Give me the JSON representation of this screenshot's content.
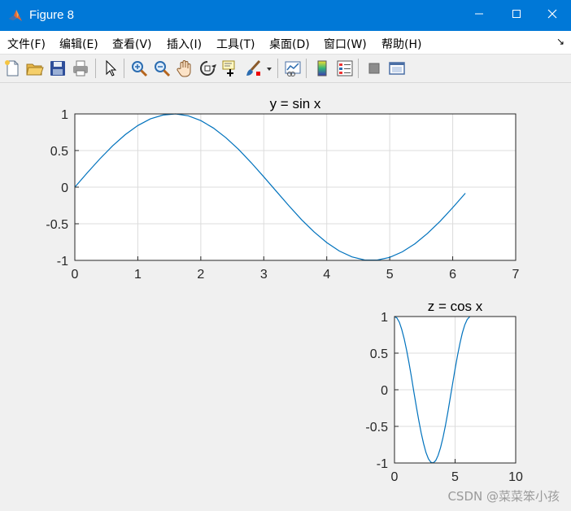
{
  "window": {
    "title": "Figure 8",
    "controls": {
      "minimize": "minimize",
      "maximize": "maximize",
      "close": "close"
    }
  },
  "menu": {
    "items": [
      {
        "label": "文件(F)"
      },
      {
        "label": "编辑(E)"
      },
      {
        "label": "查看(V)"
      },
      {
        "label": "插入(I)"
      },
      {
        "label": "工具(T)"
      },
      {
        "label": "桌面(D)"
      },
      {
        "label": "窗口(W)"
      },
      {
        "label": "帮助(H)"
      }
    ],
    "dock_glyph": "↘"
  },
  "toolbar": {
    "tools": [
      "new-figure-icon",
      "open-file-icon",
      "save-icon",
      "print-icon",
      "select-pointer-icon",
      "zoom-in-icon",
      "zoom-out-icon",
      "pan-hand-icon",
      "rotate-3d-icon",
      "data-cursor-icon",
      "brush-icon",
      "link-plot-icon",
      "colorbar-icon",
      "legend-icon",
      "hide-plot-tools-icon",
      "show-plot-tools-icon"
    ]
  },
  "colors": {
    "titlebar": "#0078d7",
    "line": "#0072bd",
    "grid": "#dcdcdc",
    "axes_border": "#262626"
  },
  "chart_data": [
    {
      "type": "line",
      "title": "y = sin x",
      "xlabel": "",
      "ylabel": "",
      "xlim": [
        0,
        7
      ],
      "ylim": [
        -1,
        1
      ],
      "xticks": [
        "0",
        "1",
        "2",
        "3",
        "4",
        "5",
        "6",
        "7"
      ],
      "yticks": [
        "1",
        "0.5",
        "0",
        "-0.5",
        "-1"
      ],
      "grid": true,
      "series": [
        {
          "x": [
            0,
            0.2,
            0.4,
            0.6,
            0.8,
            1.0,
            1.2,
            1.4,
            1.6,
            1.8,
            2.0,
            2.2,
            2.4,
            2.6,
            2.8,
            3.0,
            3.2,
            3.4,
            3.6,
            3.8,
            4.0,
            4.2,
            4.4,
            4.6,
            4.8,
            5.0,
            5.2,
            5.4,
            5.6,
            5.8,
            6.0,
            6.2
          ],
          "y": [
            0,
            0.199,
            0.389,
            0.565,
            0.717,
            0.841,
            0.932,
            0.985,
            1.0,
            0.974,
            0.909,
            0.808,
            0.675,
            0.516,
            0.335,
            0.141,
            -0.058,
            -0.256,
            -0.443,
            -0.612,
            -0.757,
            -0.872,
            -0.952,
            -0.994,
            -0.996,
            -0.959,
            -0.883,
            -0.773,
            -0.631,
            -0.465,
            -0.279,
            -0.083
          ]
        }
      ]
    },
    {
      "type": "line",
      "title": "z = cos x",
      "xlabel": "",
      "ylabel": "",
      "xlim": [
        0,
        10
      ],
      "ylim": [
        -1,
        1
      ],
      "xticks": [
        "0",
        "5",
        "10"
      ],
      "yticks": [
        "1",
        "0.5",
        "0",
        "-0.5",
        "-1"
      ],
      "grid": true,
      "series": [
        {
          "x": [
            0,
            0.2,
            0.4,
            0.6,
            0.8,
            1.0,
            1.2,
            1.4,
            1.6,
            1.8,
            2.0,
            2.2,
            2.4,
            2.6,
            2.8,
            3.0,
            3.2,
            3.4,
            3.6,
            3.8,
            4.0,
            4.2,
            4.4,
            4.6,
            4.8,
            5.0,
            5.2,
            5.4,
            5.6,
            5.8,
            6.0,
            6.2
          ],
          "y": [
            1.0,
            0.98,
            0.921,
            0.825,
            0.697,
            0.54,
            0.362,
            0.17,
            -0.029,
            -0.227,
            -0.416,
            -0.589,
            -0.737,
            -0.857,
            -0.942,
            -0.99,
            -0.998,
            -0.967,
            -0.897,
            -0.791,
            -0.654,
            -0.49,
            -0.307,
            -0.112,
            0.087,
            0.284,
            0.469,
            0.635,
            0.776,
            0.886,
            0.96,
            0.996
          ]
        }
      ]
    }
  ],
  "watermark": "CSDN @菜菜笨小孩"
}
